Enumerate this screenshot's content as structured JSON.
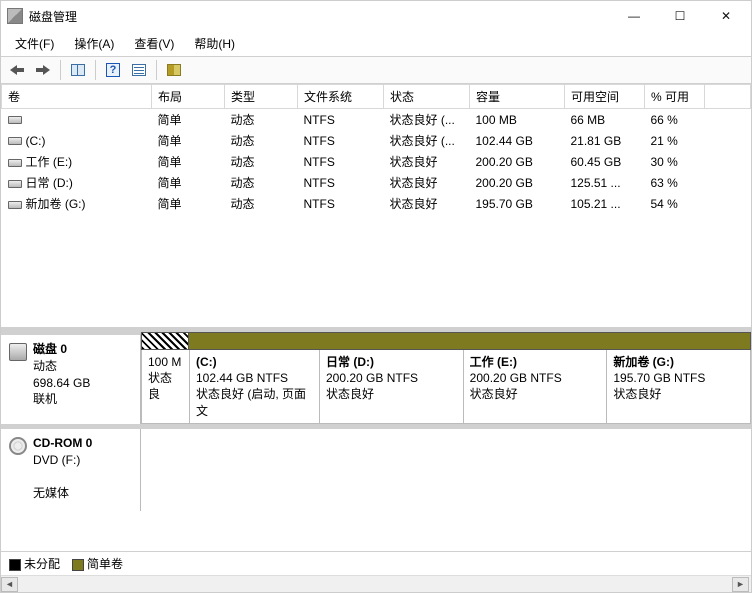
{
  "window": {
    "title": "磁盘管理"
  },
  "menu": {
    "file": "文件(F)",
    "action": "操作(A)",
    "view": "查看(V)",
    "help": "帮助(H)"
  },
  "columns": {
    "volume": "卷",
    "layout": "布局",
    "type": "类型",
    "fs": "文件系统",
    "status": "状态",
    "capacity": "容量",
    "free": "可用空间",
    "pct": "% 可用"
  },
  "vol_common": {
    "layout": "简单",
    "type": "动态",
    "fs": "NTFS"
  },
  "rows": [
    {
      "name": "",
      "status": "状态良好 (...",
      "cap": "100 MB",
      "free": "66 MB",
      "pct": "66 %"
    },
    {
      "name": "(C:)",
      "status": "状态良好 (...",
      "cap": "102.44 GB",
      "free": "21.81 GB",
      "pct": "21 %"
    },
    {
      "name": "工作 (E:)",
      "status": "状态良好",
      "cap": "200.20 GB",
      "free": "60.45 GB",
      "pct": "30 %"
    },
    {
      "name": "日常 (D:)",
      "status": "状态良好",
      "cap": "200.20 GB",
      "free": "125.51 ...",
      "pct": "63 %"
    },
    {
      "name": "新加卷 (G:)",
      "status": "状态良好",
      "cap": "195.70 GB",
      "free": "105.21 ...",
      "pct": "54 %"
    }
  ],
  "disk0": {
    "label": "磁盘 0",
    "type": "动态",
    "size": "698.64 GB",
    "state": "联机",
    "parts": {
      "p0": {
        "name": "",
        "info": "100 M",
        "extra": "状态良"
      },
      "p1": {
        "name": "(C:)",
        "info": "102.44 GB NTFS",
        "extra": "状态良好 (启动, 页面文"
      },
      "p2": {
        "name": "日常   (D:)",
        "info": "200.20 GB NTFS",
        "extra": "状态良好"
      },
      "p3": {
        "name": "工作   (E:)",
        "info": "200.20 GB NTFS",
        "extra": "状态良好"
      },
      "p4": {
        "name": "新加卷   (G:)",
        "info": "195.70 GB NTFS",
        "extra": "状态良好"
      }
    }
  },
  "cdrom": {
    "label": "CD-ROM 0",
    "drive": "DVD (F:)",
    "state": "无媒体"
  },
  "legend": {
    "unalloc": "未分配",
    "simple": "简单卷"
  }
}
